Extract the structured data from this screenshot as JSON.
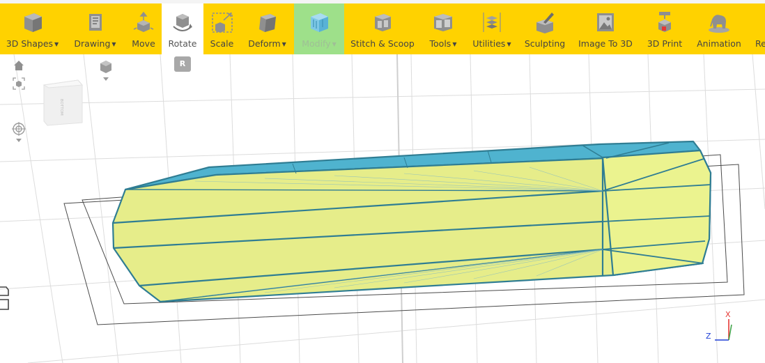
{
  "toolbar": {
    "tools": [
      {
        "label": "3D Shapes",
        "icon": "cube-icon"
      },
      {
        "label": "Drawing",
        "icon": "drawing-icon"
      },
      {
        "label": "Move",
        "icon": "move-icon"
      },
      {
        "label": "Rotate",
        "icon": "rotate-icon"
      },
      {
        "label": "Scale",
        "icon": "scale-icon"
      },
      {
        "label": "Deform",
        "icon": "deform-icon"
      },
      {
        "label": "Modify",
        "icon": "modify-icon"
      },
      {
        "label": "Stitch & Scoop",
        "icon": "stitch-scoop-icon"
      },
      {
        "label": "Tools",
        "icon": "tools-icon"
      },
      {
        "label": "Utilities",
        "icon": "utilities-icon"
      },
      {
        "label": "Sculpting",
        "icon": "sculpting-icon"
      },
      {
        "label": "Image To 3D",
        "icon": "image-to-3d-icon"
      },
      {
        "label": "3D Print",
        "icon": "3d-print-icon"
      },
      {
        "label": "Animation",
        "icon": "animation-icon"
      },
      {
        "label": "Re",
        "icon": ""
      }
    ],
    "active_tool": "Rotate",
    "highlighted_tool": "Modify"
  },
  "shortcut_hint": "R",
  "viewcube": {
    "face_label": "BOTTOM"
  },
  "axes": {
    "x_label": "X",
    "z_label": "Z"
  },
  "colors": {
    "toolbar": "#ffd200",
    "mesh_top": "#4fb3cf",
    "mesh_side": "#e6ed8a",
    "edge": "#2f7d93",
    "axis_x": "#e53935",
    "axis_z": "#1e3fd6",
    "axis_y": "#43a047"
  }
}
